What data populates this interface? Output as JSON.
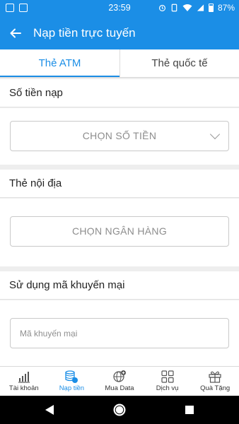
{
  "status_bar": {
    "time": "23:59",
    "battery": "87%",
    "left_icons": [
      "image-icon",
      "notification-icon"
    ],
    "right_icons": [
      "alarm-icon",
      "phone-icon",
      "wifi-icon",
      "signal-icon",
      "battery-icon"
    ]
  },
  "app_bar": {
    "back_icon": "back-arrow-icon",
    "title": "Nạp tiền trực tuyến"
  },
  "tabs": [
    {
      "label": "Thẻ ATM",
      "active": true
    },
    {
      "label": "Thẻ quốc tế",
      "active": false
    }
  ],
  "amount_section": {
    "title": "Số tiền nạp",
    "select_label": "CHỌN SỐ TIỀN",
    "chevron_icon": "chevron-down-icon"
  },
  "domestic_card_section": {
    "title": "Thẻ nội địa",
    "select_label": "CHỌN NGÂN HÀNG"
  },
  "promo_section": {
    "title": "Sử dụng mã khuyến mại",
    "input_placeholder": "Mã khuyến mại",
    "input_value": ""
  },
  "bottom_nav": [
    {
      "label": "Tài khoản",
      "icon": "chart-bars-icon",
      "active": false
    },
    {
      "label": "Nạp tiền",
      "icon": "coins-icon",
      "active": true
    },
    {
      "label": "Mua Data",
      "icon": "globe-plus-icon",
      "active": false
    },
    {
      "label": "Dịch vụ",
      "icon": "grid-icon",
      "active": false
    },
    {
      "label": "Quà Tặng",
      "icon": "gift-icon",
      "active": false
    }
  ],
  "system_nav": [
    "back-triangle-icon",
    "home-circle-icon",
    "recents-square-icon"
  ],
  "colors": {
    "primary": "#1b8ee6",
    "background": "#eeeeee",
    "surface": "#ffffff",
    "text": "#222222",
    "muted": "#8d8d8d"
  }
}
